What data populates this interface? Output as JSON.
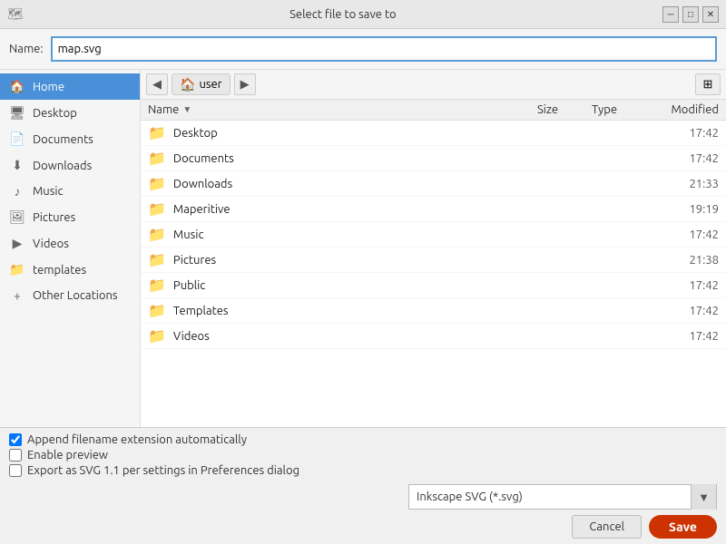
{
  "dialog": {
    "title": "Select file to save to"
  },
  "name_row": {
    "label": "Name:",
    "value": "map.svg"
  },
  "toolbar": {
    "back_label": "◀",
    "forward_label": "▶",
    "location_icon": "🏠",
    "location_label": "user",
    "grid_toggle_icon": "⊞"
  },
  "sidebar": {
    "items": [
      {
        "id": "home",
        "icon": "🏠",
        "label": "Home",
        "active": true
      },
      {
        "id": "desktop",
        "icon": "🖥",
        "label": "Desktop",
        "active": false
      },
      {
        "id": "documents",
        "icon": "📄",
        "label": "Documents",
        "active": false
      },
      {
        "id": "downloads",
        "icon": "⬇",
        "label": "Downloads",
        "active": false
      },
      {
        "id": "music",
        "icon": "♪",
        "label": "Music",
        "active": false
      },
      {
        "id": "pictures",
        "icon": "🖼",
        "label": "Pictures",
        "active": false
      },
      {
        "id": "videos",
        "icon": "▶",
        "label": "Videos",
        "active": false
      },
      {
        "id": "templates",
        "icon": "📁",
        "label": "templates",
        "active": false
      },
      {
        "id": "other-locations",
        "icon": "+",
        "label": "Other Locations",
        "active": false
      }
    ]
  },
  "file_list": {
    "columns": {
      "name": "Name",
      "size": "Size",
      "type": "Type",
      "modified": "Modified"
    },
    "rows": [
      {
        "name": "Desktop",
        "size": "",
        "type": "",
        "modified": "17:42"
      },
      {
        "name": "Documents",
        "size": "",
        "type": "",
        "modified": "17:42"
      },
      {
        "name": "Downloads",
        "size": "",
        "type": "",
        "modified": "21:33"
      },
      {
        "name": "Maperitive",
        "size": "",
        "type": "",
        "modified": "19:19"
      },
      {
        "name": "Music",
        "size": "",
        "type": "",
        "modified": "17:42"
      },
      {
        "name": "Pictures",
        "size": "",
        "type": "",
        "modified": "21:38"
      },
      {
        "name": "Public",
        "size": "",
        "type": "",
        "modified": "17:42"
      },
      {
        "name": "Templates",
        "size": "",
        "type": "",
        "modified": "17:42"
      },
      {
        "name": "Videos",
        "size": "",
        "type": "",
        "modified": "17:42"
      }
    ]
  },
  "bottom": {
    "checkbox1_label": "Append filename extension automatically",
    "checkbox1_checked": true,
    "checkbox2_label": "Enable preview",
    "checkbox2_checked": false,
    "checkbox3_label": "Export as SVG 1.1 per settings in Preferences dialog",
    "checkbox3_checked": false,
    "format_label": "Inkscape SVG (*.svg)",
    "cancel_label": "Cancel",
    "save_label": "Save"
  }
}
